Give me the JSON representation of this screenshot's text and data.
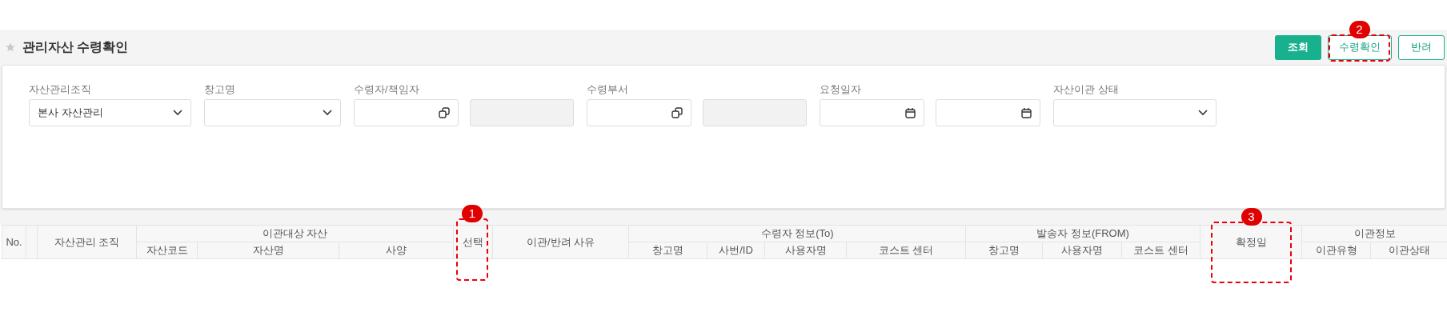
{
  "page": {
    "title": "관리자산 수령확인",
    "favorite": false
  },
  "buttons": [
    {
      "label": "조회",
      "kind": "primary"
    },
    {
      "label": "수령확인",
      "kind": "outline"
    },
    {
      "label": "반려",
      "kind": "outline"
    }
  ],
  "filters": [
    {
      "label": "자산관리조직",
      "kind": "select",
      "value": "본사 자산관리"
    },
    {
      "label": "창고명",
      "kind": "select"
    },
    {
      "label": "수령자/책임자",
      "kind": "lookup"
    },
    {
      "label": "수령부서",
      "kind": "lookup"
    },
    {
      "label": "요청일자",
      "kind": "date_range"
    },
    {
      "label": "자산이관 상태",
      "kind": "select"
    }
  ],
  "table": {
    "columns": [
      {
        "label": "No."
      },
      {
        "label": "자산관리 조직"
      },
      {
        "label": "이관대상 자산",
        "children": [
          {
            "label": "자산코드"
          },
          {
            "label": "자산명"
          },
          {
            "label": "사양"
          }
        ]
      },
      {
        "label": "선택"
      },
      {
        "label": "이관/반려 사유"
      },
      {
        "label": "수령자 정보(To)",
        "children": [
          {
            "label": "창고명"
          },
          {
            "label": "사번/ID"
          },
          {
            "label": "사용자명"
          },
          {
            "label": "코스트 센터"
          }
        ]
      },
      {
        "label": "발송자 정보(FROM)",
        "children": [
          {
            "label": "창고명"
          },
          {
            "label": "사용자명"
          },
          {
            "label": "코스트 센터"
          }
        ]
      },
      {
        "label": "확정일"
      },
      {
        "label": "이관정보",
        "children": [
          {
            "label": "이관유형"
          },
          {
            "label": "이관상태"
          }
        ]
      }
    ]
  },
  "annotations": [
    {
      "label": "1"
    },
    {
      "label": "2"
    },
    {
      "label": "3"
    }
  ]
}
